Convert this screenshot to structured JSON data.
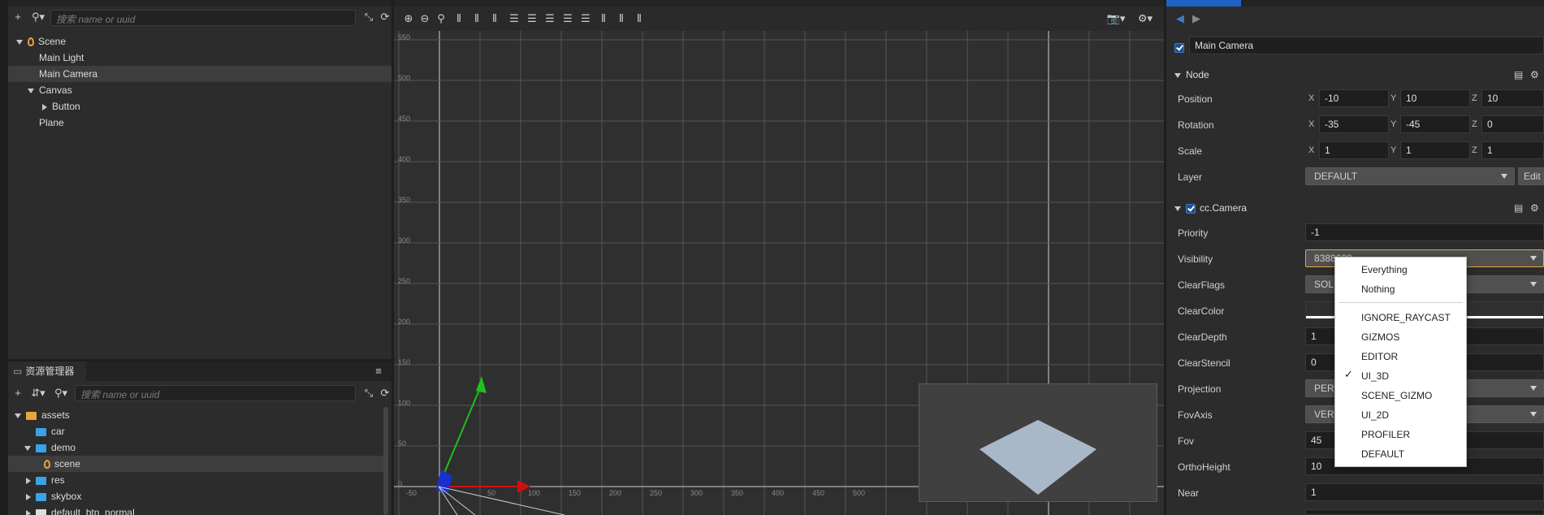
{
  "hierarchy": {
    "search_placeholder": "搜索 name or uuid",
    "tree": [
      "Scene",
      "Main Light",
      "Main Camera",
      "Canvas",
      "Button",
      "Plane"
    ]
  },
  "assets": {
    "tab_title": "资源管理器",
    "search_placeholder": "搜索 name or uuid",
    "tree": [
      "assets",
      "car",
      "demo",
      "scene",
      "res",
      "skybox",
      "default_btn_normal"
    ]
  },
  "scene": {
    "grid_y_labels": [
      "550",
      "500",
      "450",
      "400",
      "350",
      "300",
      "250",
      "200",
      "150",
      "100",
      "50",
      "0"
    ],
    "grid_x_labels": [
      "-50",
      "50",
      "100",
      "150",
      "200",
      "250",
      "300",
      "350",
      "400",
      "450",
      "500"
    ]
  },
  "inspector": {
    "node_name": "Main Camera",
    "node_section": "Node",
    "position": {
      "label": "Position",
      "x": "-10",
      "y": "10",
      "z": "10"
    },
    "rotation": {
      "label": "Rotation",
      "x": "-35",
      "y": "-45",
      "z": "0"
    },
    "scale": {
      "label": "Scale",
      "x": "1",
      "y": "1",
      "z": "1"
    },
    "layer": {
      "label": "Layer",
      "value": "DEFAULT",
      "edit": "Edit"
    },
    "camera_section": "cc.Camera",
    "axis_x": "X",
    "axis_y": "Y",
    "axis_z": "Z",
    "props": {
      "priority": {
        "label": "Priority",
        "value": "-1"
      },
      "visibility": {
        "label": "Visibility",
        "value": "8388608"
      },
      "clearflags": {
        "label": "ClearFlags",
        "value": "SOLID_COLOR"
      },
      "clearcolor": {
        "label": "ClearColor"
      },
      "cleardepth": {
        "label": "ClearDepth",
        "value": "1"
      },
      "clearstencil": {
        "label": "ClearStencil",
        "value": "0"
      },
      "projection": {
        "label": "Projection",
        "value": "PERSPECTIVE"
      },
      "fovaxis": {
        "label": "FovAxis",
        "value": "VERTICAL"
      },
      "fov": {
        "label": "Fov",
        "value": "45"
      },
      "orthoheight": {
        "label": "OrthoHeight",
        "value": "10"
      },
      "near": {
        "label": "Near",
        "value": "1"
      }
    }
  },
  "visibility_menu": {
    "items": [
      "Everything",
      "Nothing",
      "IGNORE_RAYCAST",
      "GIZMOS",
      "EDITOR",
      "UI_3D",
      "SCENE_GIZMO",
      "UI_2D",
      "PROFILER",
      "DEFAULT"
    ],
    "checked": "UI_3D"
  },
  "colors": {
    "accent": "#3c7bc8",
    "panel": "#2c2c2c",
    "grid": "#5a5a5a"
  }
}
